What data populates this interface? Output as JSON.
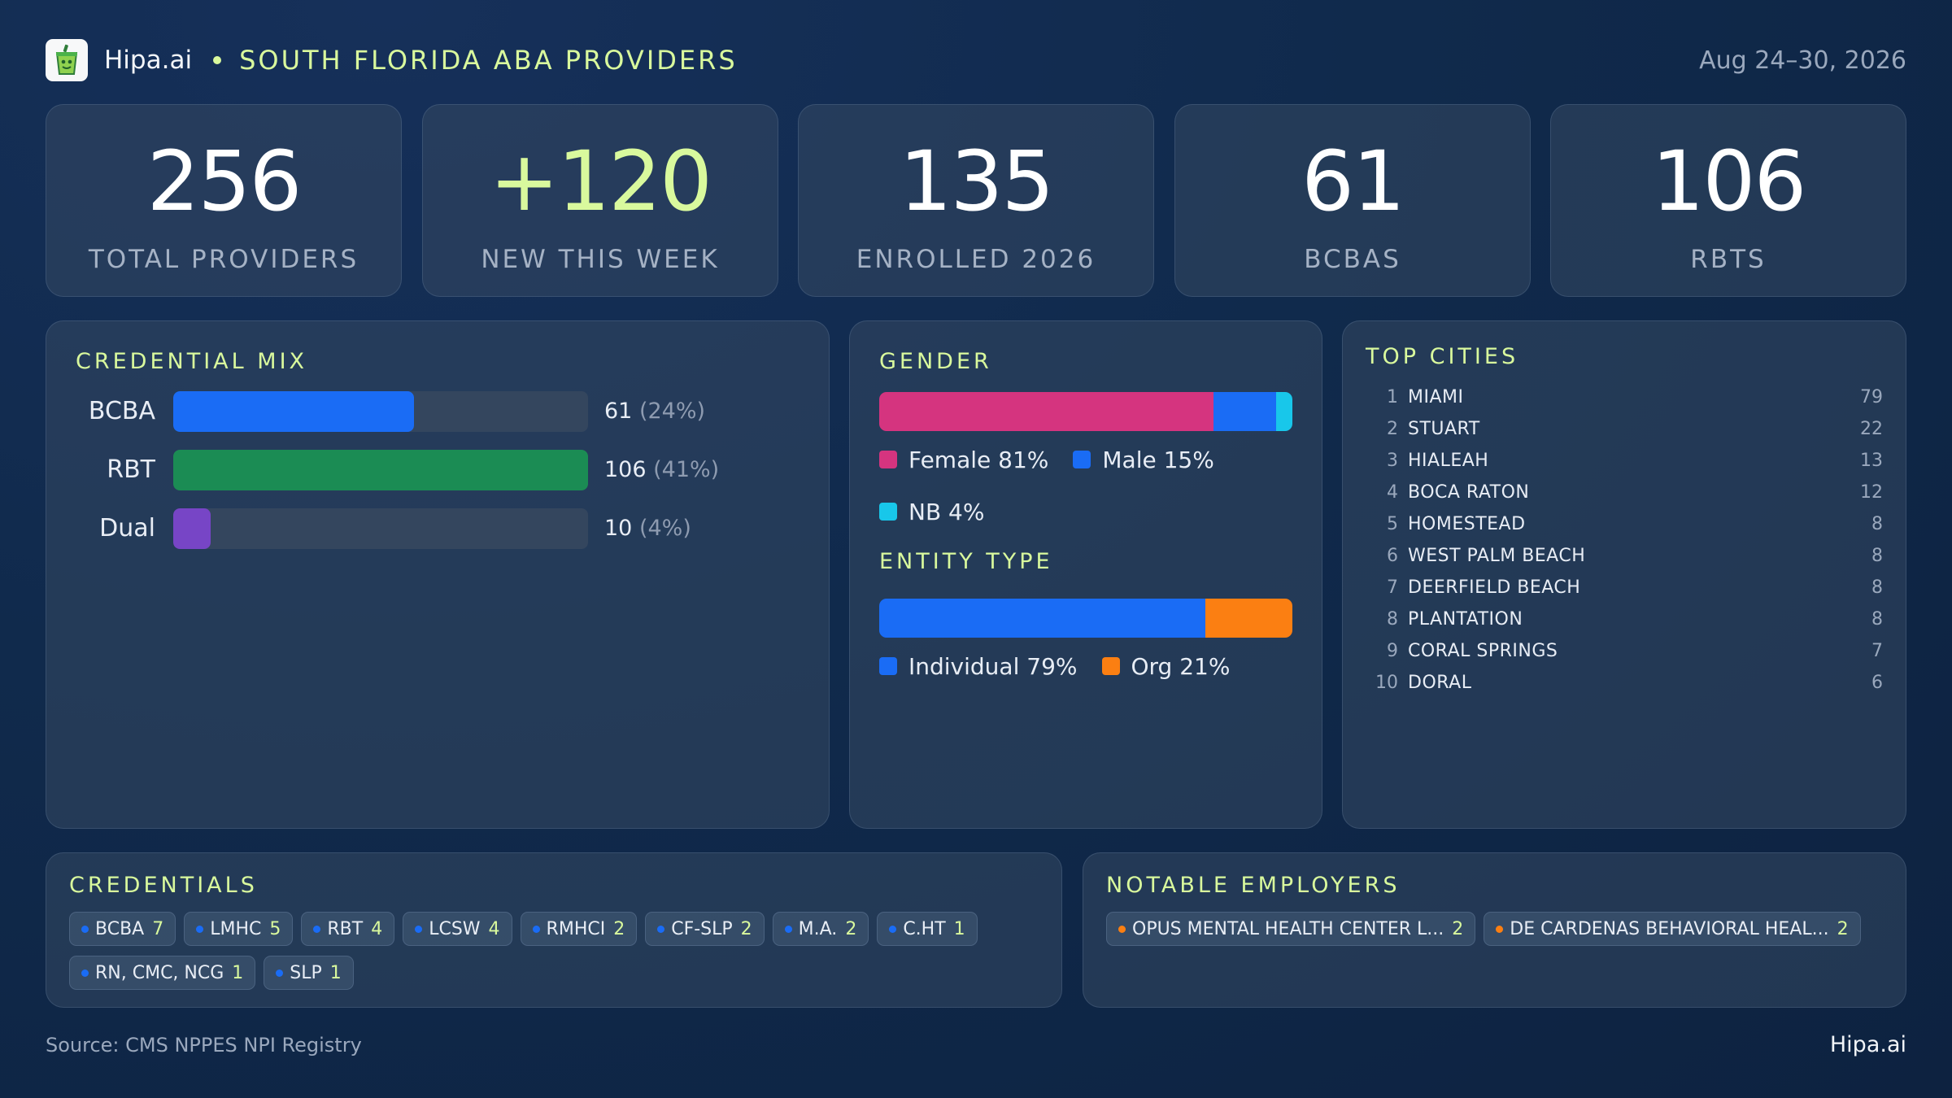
{
  "header": {
    "brand": "Hipa.ai",
    "title": "SOUTH FLORIDA ABA PROVIDERS",
    "date_range": "Aug 24–30, 2026",
    "logo_icon": "cup-icon"
  },
  "kpis": [
    {
      "value": "256",
      "label": "TOTAL PROVIDERS"
    },
    {
      "value": "+120",
      "label": "NEW THIS WEEK"
    },
    {
      "value": "135",
      "label": "ENROLLED 2026"
    },
    {
      "value": "61",
      "label": "BCBAS"
    },
    {
      "value": "106",
      "label": "RBTS"
    }
  ],
  "credential_mix": {
    "title": "CREDENTIAL MIX",
    "rows": [
      {
        "label": "BCBA",
        "count": "61",
        "pct": "(24%)",
        "fraction": 0.58,
        "color": "#1a6cf5"
      },
      {
        "label": "RBT",
        "count": "106",
        "pct": "(41%)",
        "fraction": 1.0,
        "color": "#1b8c54"
      },
      {
        "label": "Dual",
        "count": "10",
        "pct": "(4%)",
        "fraction": 0.09,
        "color": "#7745c6"
      }
    ]
  },
  "gender": {
    "title": "GENDER",
    "segments": [
      {
        "label": "Female 81%",
        "percent": 81,
        "color": "#d5347f"
      },
      {
        "label": "Male 15%",
        "percent": 15,
        "color": "#1a6cf5"
      },
      {
        "label": "NB 4%",
        "percent": 4,
        "color": "#18c7ea"
      }
    ]
  },
  "entity_type": {
    "title": "ENTITY TYPE",
    "segments": [
      {
        "label": "Individual 79%",
        "percent": 79,
        "color": "#1a6cf5"
      },
      {
        "label": "Org 21%",
        "percent": 21,
        "color": "#fb7f12"
      }
    ]
  },
  "top_cities": {
    "title": "TOP CITIES",
    "items": [
      {
        "rank": "1",
        "name": "MIAMI",
        "count": "79"
      },
      {
        "rank": "2",
        "name": "STUART",
        "count": "22"
      },
      {
        "rank": "3",
        "name": "HIALEAH",
        "count": "13"
      },
      {
        "rank": "4",
        "name": "BOCA RATON",
        "count": "12"
      },
      {
        "rank": "5",
        "name": "HOMESTEAD",
        "count": "8"
      },
      {
        "rank": "6",
        "name": "WEST PALM BEACH",
        "count": "8"
      },
      {
        "rank": "7",
        "name": "DEERFIELD BEACH",
        "count": "8"
      },
      {
        "rank": "8",
        "name": "PLANTATION",
        "count": "8"
      },
      {
        "rank": "9",
        "name": "CORAL SPRINGS",
        "count": "7"
      },
      {
        "rank": "10",
        "name": "DORAL",
        "count": "6"
      }
    ]
  },
  "credentials": {
    "title": "CREDENTIALS",
    "dot_color": "#1a6cf5",
    "chips": [
      {
        "name": "BCBA",
        "count": "7"
      },
      {
        "name": "LMHC",
        "count": "5"
      },
      {
        "name": "RBT",
        "count": "4"
      },
      {
        "name": "LCSW",
        "count": "4"
      },
      {
        "name": "RMHCI",
        "count": "2"
      },
      {
        "name": "CF-SLP",
        "count": "2"
      },
      {
        "name": "M.A.",
        "count": "2"
      },
      {
        "name": "C.HT",
        "count": "1"
      },
      {
        "name": "RN, CMC, NCG",
        "count": "1"
      },
      {
        "name": "SLP",
        "count": "1"
      }
    ]
  },
  "employers": {
    "title": "NOTABLE EMPLOYERS",
    "dot_color": "#fb7f12",
    "chips": [
      {
        "name": "OPUS MENTAL HEALTH CENTER L...",
        "count": "2"
      },
      {
        "name": "DE CARDENAS BEHAVIORAL HEAL...",
        "count": "2"
      }
    ]
  },
  "footer": {
    "source": "Source: CMS NPPES NPI Registry",
    "brand": "Hipa.ai"
  }
}
